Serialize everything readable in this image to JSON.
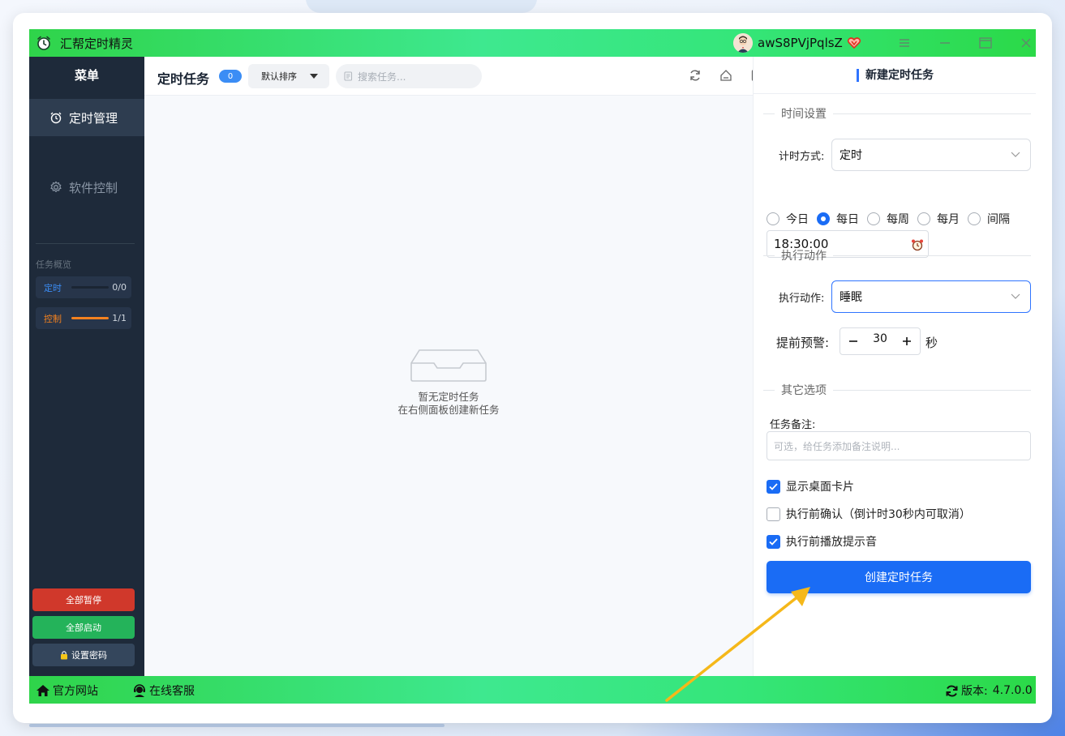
{
  "window": {
    "title": "汇帮定时精灵",
    "username": "awS8PVjPqlsZ"
  },
  "sidebar": {
    "menu_title": "菜单",
    "items": [
      {
        "label": "定时管理",
        "icon": "alarm-clock-icon",
        "active": true
      },
      {
        "label": "软件控制",
        "icon": "gear-icon",
        "active": false
      }
    ],
    "overview_label": "任务概览",
    "stats": [
      {
        "label": "定时",
        "count": "0/0",
        "progress": 0,
        "color": "#3b8df5"
      },
      {
        "label": "控制",
        "count": "1/1",
        "progress": 1,
        "color": "#f5821f"
      }
    ],
    "buttons": {
      "pause_all": "全部暂停",
      "start_all": "全部启动",
      "set_password": "设置密码"
    }
  },
  "center": {
    "title": "定时任务",
    "count": "0",
    "sort_label": "默认排序",
    "search_placeholder": "搜索任务...",
    "empty_line1": "暂无定时任务",
    "empty_line2": "在右侧面板创建新任务"
  },
  "panel": {
    "title": "新建定时任务",
    "section_time": "时间设置",
    "timing_mode_label": "计时方式:",
    "timing_mode_value": "定时",
    "radio_options": [
      "今日",
      "每日",
      "每周",
      "每月",
      "间隔"
    ],
    "radio_selected": "每日",
    "time_value": "18:30:00",
    "section_action": "执行动作",
    "action_label": "执行动作:",
    "action_value": "睡眠",
    "warning_label": "提前预警:",
    "warning_value": "30",
    "warning_unit": "秒",
    "section_other": "其它选项",
    "note_label": "任务备注:",
    "note_placeholder": "可选，给任务添加备注说明...",
    "checks": [
      {
        "label": "显示桌面卡片",
        "checked": true
      },
      {
        "label": "执行前确认（倒计时30秒内可取消）",
        "checked": false
      },
      {
        "label": "执行前播放提示音",
        "checked": true
      }
    ],
    "create_button": "创建定时任务"
  },
  "footer": {
    "website": "官方网站",
    "support": "在线客服",
    "version_label": "版本:",
    "version": "4.7.0.0"
  },
  "colors": {
    "titlebar_green": "#2fd44a",
    "sidebar_bg": "#1e2a3a",
    "primary_blue": "#1a6cf5",
    "pause_red": "#d0382b",
    "start_green": "#24b35a",
    "annotation_arrow": "#f5b81a"
  }
}
